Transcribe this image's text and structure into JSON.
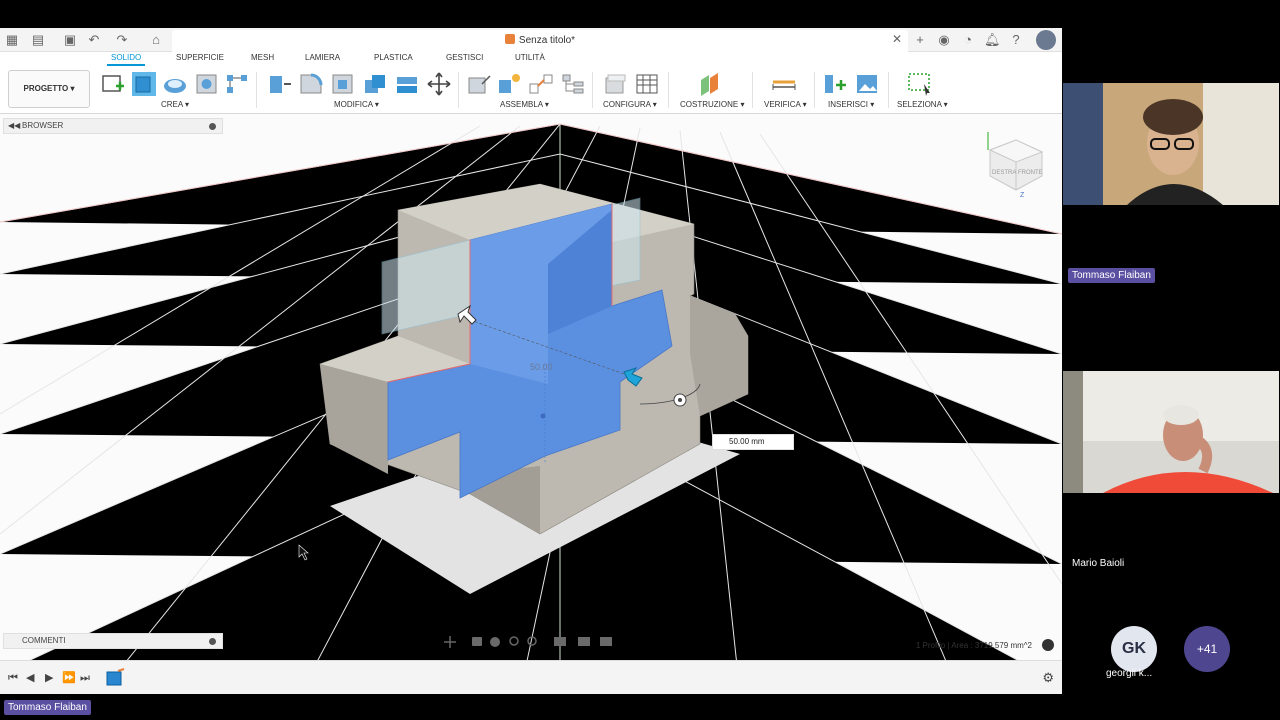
{
  "app": {
    "document_title": "Senza titolo*",
    "ribbon_tabs": [
      "SOLIDO",
      "SUPERFICIE",
      "MESH",
      "LAMIERA",
      "PLASTICA",
      "GESTISCI",
      "UTILITÀ"
    ],
    "active_tab": "SOLIDO",
    "project_button": "PROGETTO ▾",
    "groups": {
      "crea": "CREA ▾",
      "modifica": "MODIFICA ▾",
      "assembla": "ASSEMBLA ▾",
      "configura": "CONFIGURA ▾",
      "costruzione": "COSTRUZIONE ▾",
      "verifica": "VERIFICA ▾",
      "inserisci": "INSERISCI ▾",
      "seleziona": "SELEZIONA ▾"
    },
    "browser_label": "BROWSER",
    "comments_label": "COMMENTI",
    "status_text": "1 Profilo | Area : 3719.579 mm^2",
    "dimension_input": "50.00 mm",
    "dimension_label": "50.00",
    "viewcube": {
      "left_face": "DESTRA",
      "front_face": "FRONTE",
      "axis": "Z"
    }
  },
  "call": {
    "participant_1": "Tommaso Flaiban",
    "participant_2": "Mario Baioli",
    "avatar_initials": "GK",
    "avatar_name": "georgii k...",
    "more_count": "+41",
    "presenter_label": "Tommaso Flaiban"
  },
  "colors": {
    "accent": "#0696d7",
    "selection_blue": "#5b8fe0",
    "model_gray": "#b7b3aa",
    "name_tag_bg": "#5a4fa0"
  }
}
